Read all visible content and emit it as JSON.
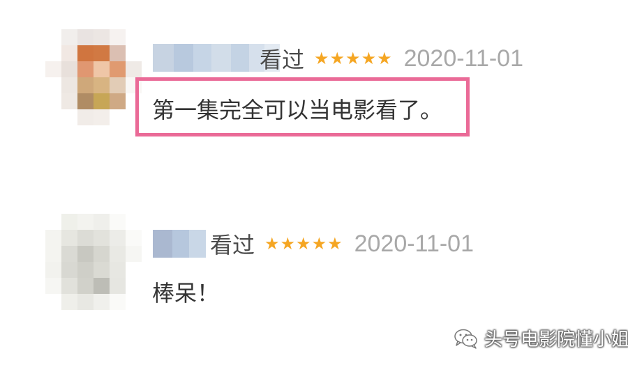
{
  "comments": [
    {
      "watched_label": "看过",
      "stars": "★★★★★",
      "date": "2020-11-01",
      "text": "第一集完全可以当电影看了。"
    },
    {
      "watched_label": "看过",
      "stars": "★★★★★",
      "date": "2020-11-01",
      "text": "棒呆！"
    }
  ],
  "watermark": {
    "text": "头号电影院懂小姐",
    "icon": "wechat-icon"
  },
  "colors": {
    "star": "#f5a623",
    "date": "#a8a8a8",
    "highlight": "#ea6a97",
    "text": "#333333"
  },
  "avatars": {
    "avatar_1": [
      "#ffffff",
      "#f1eeec",
      "#e9e3e1",
      "#ece6e3",
      "#f6f2f0",
      "#ffffff",
      "#ffffff",
      "#f1e8e3",
      "#d0753f",
      "#d17943",
      "#dbbfb2",
      "#ffffff",
      "#f6f1ee",
      "#e8e0db",
      "#e09771",
      "#efc6a7",
      "#e09a70",
      "#efeae6",
      "#ffffff",
      "#ede7e2",
      "#cfa87a",
      "#d8b482",
      "#e2ccb6",
      "#f9f7f5",
      "#ffffff",
      "#efe9e4",
      "#b08c64",
      "#c7a656",
      "#cfa985",
      "#ffffff",
      "#ffffff",
      "#ffffff",
      "#f1ece8",
      "#f3eeea",
      "#ffffff",
      "#ffffff"
    ],
    "avatar_2": [
      "#ffffff",
      "#eff0ea",
      "#f3f3ef",
      "#efefeb",
      "#fafaf8",
      "#ffffff",
      "#f4f4f0",
      "#e6e6e0",
      "#dcdcd6",
      "#e2e2dc",
      "#ececE8",
      "#fafaf8",
      "#f4f4f0",
      "#dadad4",
      "#c8c8c1",
      "#d6d6cf",
      "#e9e9e4",
      "#f6f6f3",
      "#f2f2ee",
      "#d8d8d2",
      "#cfcfc8",
      "#dadad3",
      "#e7e7e2",
      "#ffffff",
      "#f6f6f3",
      "#e1e1db",
      "#d1d1ca",
      "#bdbdb6",
      "#e6e6e1",
      "#ffffff",
      "#ffffff",
      "#efefea",
      "#e8e8e3",
      "#f0f0ec",
      "#fafaf8",
      "#ffffff"
    ]
  },
  "name_mosaics": {
    "name_1": [
      [
        "#c7d3e2",
        30
      ],
      [
        "#b8c9de",
        28
      ],
      [
        "#c6d5e6",
        26
      ],
      [
        "#d2dde9",
        28
      ],
      [
        "#c4d3e4",
        26
      ],
      [
        "#d6e0ec",
        22
      ],
      [
        "#e3eaf2",
        22
      ]
    ],
    "name_2": [
      [
        "#aab8d0",
        28
      ],
      [
        "#b6c7dd",
        24
      ],
      [
        "#c9d7e7",
        24
      ]
    ]
  }
}
